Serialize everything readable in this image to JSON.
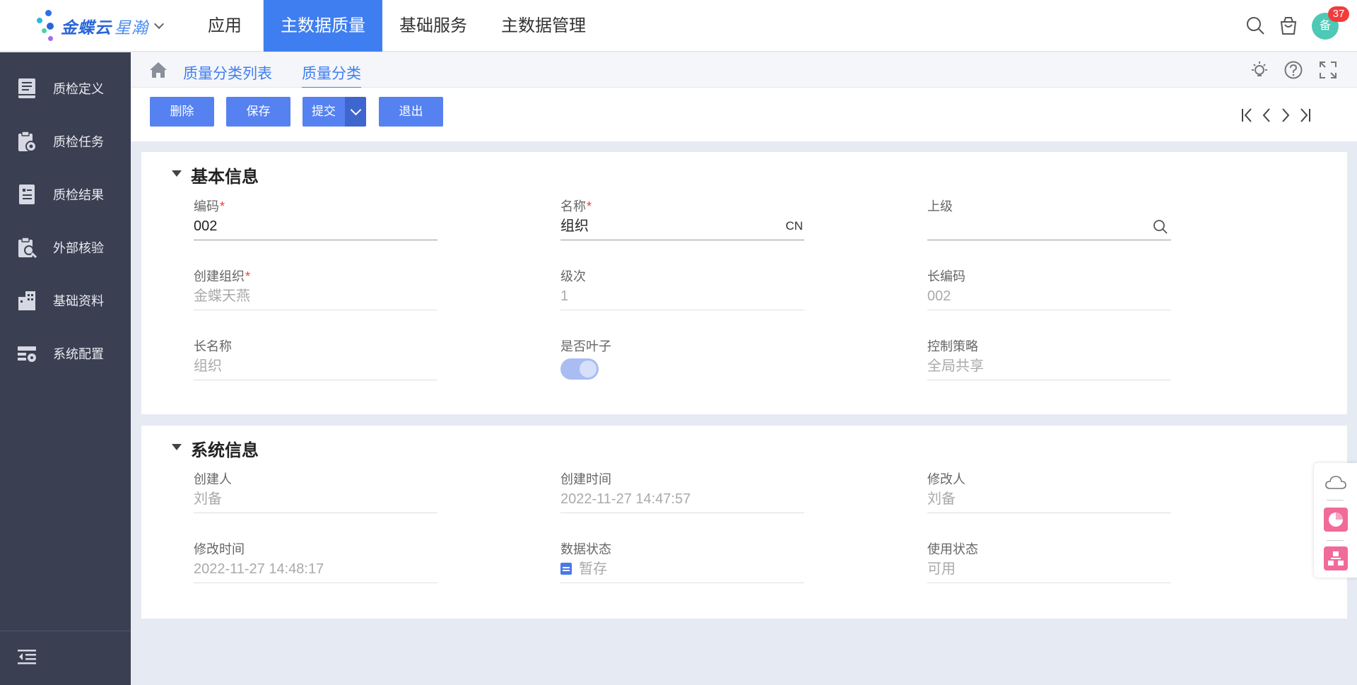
{
  "app": {
    "logo_text": "金蝶云",
    "logo_sub": "星瀚"
  },
  "top_nav": {
    "tabs": [
      {
        "label": "应用"
      },
      {
        "label": "主数据质量",
        "active": true
      },
      {
        "label": "基础服务"
      },
      {
        "label": "主数据管理"
      }
    ],
    "icons": [
      "search-icon",
      "shopping-bag-icon"
    ],
    "avatar_text": "备",
    "notification_count": "37"
  },
  "sidebar": {
    "items": [
      {
        "label": "质检定义",
        "icon": "book-icon"
      },
      {
        "label": "质检任务",
        "icon": "clipboard-gear-icon"
      },
      {
        "label": "质检结果",
        "icon": "report-icon"
      },
      {
        "label": "外部核验",
        "icon": "clipboard-search-icon"
      },
      {
        "label": "基础资料",
        "icon": "building-icon"
      },
      {
        "label": "系统配置",
        "icon": "settings-panel-icon"
      }
    ],
    "collapse_icon": "collapse-menu-icon"
  },
  "breadcrumb": {
    "items": [
      {
        "label": "质量分类列表"
      },
      {
        "label": "质量分类",
        "active": true
      }
    ],
    "right_icons": [
      "lightbulb-icon",
      "help-icon",
      "fullscreen-icon"
    ]
  },
  "toolbar": {
    "delete_label": "删除",
    "save_label": "保存",
    "submit_label": "提交",
    "exit_label": "退出",
    "pager_icons": [
      "first-page-icon",
      "prev-page-icon",
      "next-page-icon",
      "last-page-icon"
    ]
  },
  "basic_info": {
    "title": "基本信息",
    "code": {
      "label": "编码",
      "value": "002",
      "required": true
    },
    "name": {
      "label": "名称",
      "value": "组织",
      "lang": "CN",
      "required": true
    },
    "parent": {
      "label": "上级",
      "value": ""
    },
    "org": {
      "label": "创建组织",
      "value": "金蝶天燕",
      "required": true
    },
    "level": {
      "label": "级次",
      "value": "1"
    },
    "long_code": {
      "label": "长编码",
      "value": "002"
    },
    "long_name": {
      "label": "长名称",
      "value": "组织"
    },
    "is_leaf": {
      "label": "是否叶子",
      "value": true
    },
    "control": {
      "label": "控制策略",
      "value": "全局共享"
    }
  },
  "system_info": {
    "title": "系统信息",
    "creator": {
      "label": "创建人",
      "value": "刘备"
    },
    "create_time": {
      "label": "创建时间",
      "value": "2022-11-27 14:47:57"
    },
    "modifier": {
      "label": "修改人",
      "value": "刘备"
    },
    "modify_time": {
      "label": "修改时间",
      "value": "2022-11-27 14:48:17"
    },
    "data_status": {
      "label": "数据状态",
      "value": "暂存"
    },
    "use_status": {
      "label": "使用状态",
      "value": "可用"
    }
  },
  "float_widget": {
    "icons": [
      "cloud-icon",
      "chart-ball-icon",
      "org-chart-icon"
    ]
  },
  "colors": {
    "primary": "#3f7ef0",
    "button": "#5582f0",
    "sidebar": "#3b3f52",
    "required": "#f23b3b",
    "badge": "#f23b3b",
    "avatar": "#4dc9b5"
  }
}
